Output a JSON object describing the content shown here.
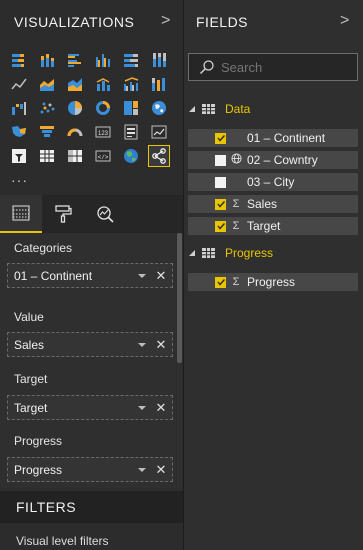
{
  "visualizations": {
    "header": "VISUALIZATIONS",
    "chevron": ">",
    "more": "···",
    "icons": [
      "stacked-bar-icon",
      "stacked-column-icon",
      "clustered-bar-icon",
      "clustered-column-icon",
      "100-stacked-bar-icon",
      "100-stacked-column-icon",
      "line-chart-icon",
      "area-chart-icon",
      "stacked-area-icon",
      "line-column-icon",
      "line-clustered-column-icon",
      "ribbon-chart-icon",
      "waterfall-icon",
      "scatter-icon",
      "pie-chart-icon",
      "donut-chart-icon",
      "treemap-icon",
      "map-icon",
      "filled-map-icon",
      "funnel-icon",
      "gauge-icon",
      "card-icon",
      "multi-row-card-icon",
      "kpi-icon",
      "slicer-icon",
      "table-icon",
      "matrix-icon",
      "custom-visual-icon",
      "globe-icon",
      "network-visual-icon"
    ],
    "selected_icon": "network-visual-icon",
    "tabs": [
      "fields-tab",
      "format-tab",
      "analytics-tab"
    ],
    "active_tab": "fields-tab",
    "wells": [
      {
        "label": "Categories",
        "field": "01 – Continent"
      },
      {
        "label": "Value",
        "field": "Sales"
      },
      {
        "label": "Target",
        "field": "Target"
      },
      {
        "label": "Progress",
        "field": "Progress"
      }
    ],
    "remove_glyph": "✕"
  },
  "filters": {
    "header": "FILTERS",
    "visual_level": "Visual level filters"
  },
  "fields": {
    "header": "FIELDS",
    "chevron": ">",
    "search_placeholder": "Search",
    "groups": [
      {
        "name": "Data",
        "items": [
          {
            "label": "01 – Continent",
            "checked": true,
            "type": ""
          },
          {
            "label": "02 – Cowntry",
            "checked": false,
            "type": "globe"
          },
          {
            "label": "03 – City",
            "checked": false,
            "type": ""
          },
          {
            "label": "Sales",
            "checked": true,
            "type": "Σ"
          },
          {
            "label": "Target",
            "checked": true,
            "type": "Σ"
          }
        ]
      },
      {
        "name": "Progress",
        "items": [
          {
            "label": "Progress",
            "checked": true,
            "type": "Σ"
          }
        ]
      }
    ]
  },
  "colors": {
    "accent": "#e8c600",
    "pane_bg": "#2f2f2f",
    "field_row_bg": "#474747"
  }
}
